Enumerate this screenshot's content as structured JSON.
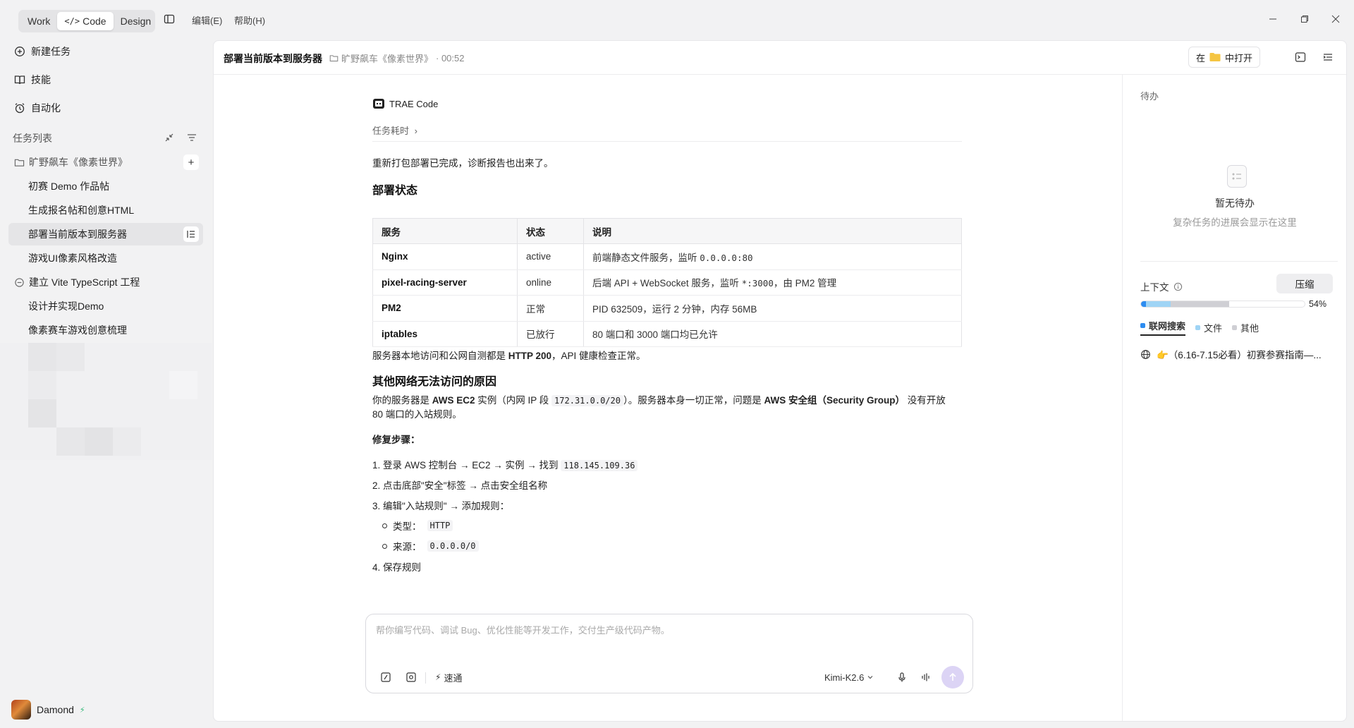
{
  "topbar": {
    "modes": [
      "Work",
      "Code",
      "Design"
    ],
    "active_mode": "Code",
    "menu": [
      "编辑(E)",
      "帮助(H)"
    ]
  },
  "sidebar": {
    "nav": [
      {
        "label": "新建任务",
        "icon": "new-task-icon"
      },
      {
        "label": "技能",
        "icon": "book-icon"
      },
      {
        "label": "自动化",
        "icon": "alarm-clock-icon"
      }
    ],
    "section_title": "任务列表",
    "projects": [
      {
        "name": "旷野飙车《像素世界》",
        "icon": "folder-icon",
        "tasks": [
          "初赛 Demo 作品帖",
          "生成报名帖和创意HTML",
          "部署当前版本到服务器",
          "游戏UI像素风格改造"
        ]
      },
      {
        "name": "建立 Vite TypeScript 工程",
        "icon": "minus-circle-icon",
        "tasks": [
          "设计并实现Demo",
          "像素赛车游戏创意梳理"
        ]
      }
    ],
    "active_task": "部署当前版本到服务器",
    "user": {
      "name": "Damond",
      "badge": "⚡"
    }
  },
  "header": {
    "title": "部署当前版本到服务器",
    "project": "旷野飙车《像素世界》",
    "elapsed": "· 00:52",
    "open_in_prefix": "在",
    "open_in_suffix": "中打开"
  },
  "conversation": {
    "agent_name": "TRAE Code",
    "task_time_label": "任务耗时",
    "intro": "重新打包部署已完成，诊断报告也出来了。",
    "section1_title": "部署状态",
    "table": {
      "headers": [
        "服务",
        "状态",
        "说明"
      ],
      "rows": [
        {
          "service": "Nginx",
          "status": "active",
          "desc_pre": "前端静态文件服务，监听 ",
          "desc_code": "0.0.0.0:80",
          "desc_post": ""
        },
        {
          "service": "pixel-racing-server",
          "status": "online",
          "desc_pre": "后端 API + WebSocket 服务，监听 ",
          "desc_code": "*:3000",
          "desc_post": "，由 PM2 管理"
        },
        {
          "service": "PM2",
          "status": "正常",
          "desc_pre": "PID 632509，运行 2 分钟，内存 56MB",
          "desc_code": "",
          "desc_post": ""
        },
        {
          "service": "iptables",
          "status": "已放行",
          "desc_pre": "80 端口和 3000 端口均已允许",
          "desc_code": "",
          "desc_post": ""
        }
      ]
    },
    "health_pre": "服务器本地访问和公网自测都是 ",
    "health_bold": "HTTP 200",
    "health_post": "，API 健康检查正常。",
    "section2_title": "其他网络无法访问的原因",
    "reason_1": "你的服务器是 ",
    "reason_bold1": "AWS EC2",
    "reason_2": " 实例（内网 IP 段 ",
    "reason_code": "172.31.0.0/20",
    "reason_3": "）。服务器本身一切正常，问题是 ",
    "reason_bold2": "AWS 安全组（Security Group）",
    "reason_4": " 没有开放",
    "reason_line2": "80 端口的入站规则。",
    "fix_title": "修复步骤：",
    "steps": {
      "s1_pre": "1. 登录 AWS 控制台 → EC2 → 实例 → 找到 ",
      "s1_code": "118.145.109.36",
      "s2": "2. 点击底部\"安全\"标签 → 点击安全组名称",
      "s3": "3. 编辑\"入站规则\" → 添加规则：",
      "s3a_label": "类型：",
      "s3a_code": "HTTP",
      "s3b_label": "来源：",
      "s3b_code": "0.0.0.0/0",
      "s4": "4. 保存规则"
    }
  },
  "composer": {
    "placeholder": "帮你编写代码、调试 Bug、优化性能等开发工作，交付生产级代码产物。",
    "speed_label": "速通",
    "model": "Kimi-K2.6"
  },
  "right_panel": {
    "todo_title": "待办",
    "empty_title": "暂无待办",
    "empty_sub": "复杂任务的进展会显示在这里",
    "context_title": "上下文",
    "compress_label": "压缩",
    "context_percent": 54,
    "context_percent_label": "54%",
    "legend": [
      "联网搜索",
      "文件",
      "其他"
    ],
    "link_text": "👉（6.16-7.15必看）初赛参赛指南—..."
  },
  "colors": {
    "accent": "#8c6ff0",
    "legend_web": "#2d8cf0",
    "legend_file": "#9fd4f5",
    "legend_other": "#cfcfd4"
  }
}
